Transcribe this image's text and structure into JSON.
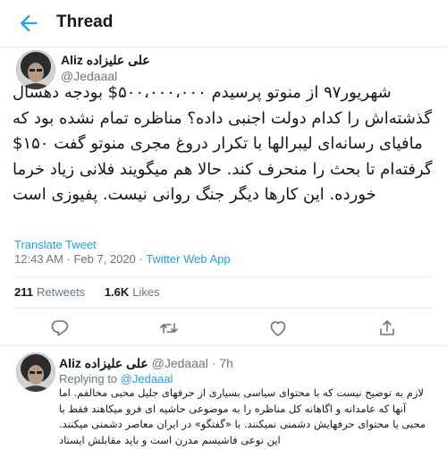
{
  "header": {
    "title": "Thread"
  },
  "tweet": {
    "author_name": "Aliz علی علیزاده",
    "author_handle": "@Jedaaal",
    "text": "شهریور۹۷ از منوتو پرسیدم ۵۰۰،۰۰۰،۰۰۰$ بودجه دهسال گذشته‌اش را کدام دولت اجنبی داده؟ مناظره تمام نشده بود که مافیای رسانه‌ای لیبرالها با تکرار دروغ مجری منوتو گفت ۱۵۰$ گرفته‌ام تا بحث را منحرف کند. حالا هم میگویند فلانی زیاد خرما خورده. این کارها دیگر جنگ روانی نیست. پفیوزی است",
    "translate_label": "Translate Tweet",
    "timestamp": "12:43 AM · Feb 7, 2020 · ",
    "via": "Twitter Web App",
    "retweets_count": "211",
    "retweets_label": "Retweets",
    "likes_count": "1.6K",
    "likes_label": "Likes"
  },
  "reply": {
    "author_name": "Aliz علی علیزاده",
    "author_meta": " @Jedaaal · 7h",
    "replying_label": "Replying to ",
    "replying_to": "@Jedaaal",
    "text": "لازم به توضیح نیست که با محتوای سیاسی بسیاری از حرفهای جلیل محبی مخالفم. اما آنها که عامدانه و اگاهانه کل مناظره را به موضوعی حاشیه ای فرو میکاهند فقط با محبی یا محتوای حرفهایش دشمنی نمیکنند. با «گفتگو» در ایران معاصر دشمنی میکنند. این نوعی فاشیسم مدرن است و باید مقابلش ایستاد"
  },
  "colors": {
    "accent": "#1da1f2",
    "muted": "#657786",
    "text": "#14171a",
    "border": "#e6ecf0"
  },
  "icons": [
    "back-arrow-icon",
    "reply-icon",
    "retweet-icon",
    "like-icon",
    "share-icon"
  ]
}
